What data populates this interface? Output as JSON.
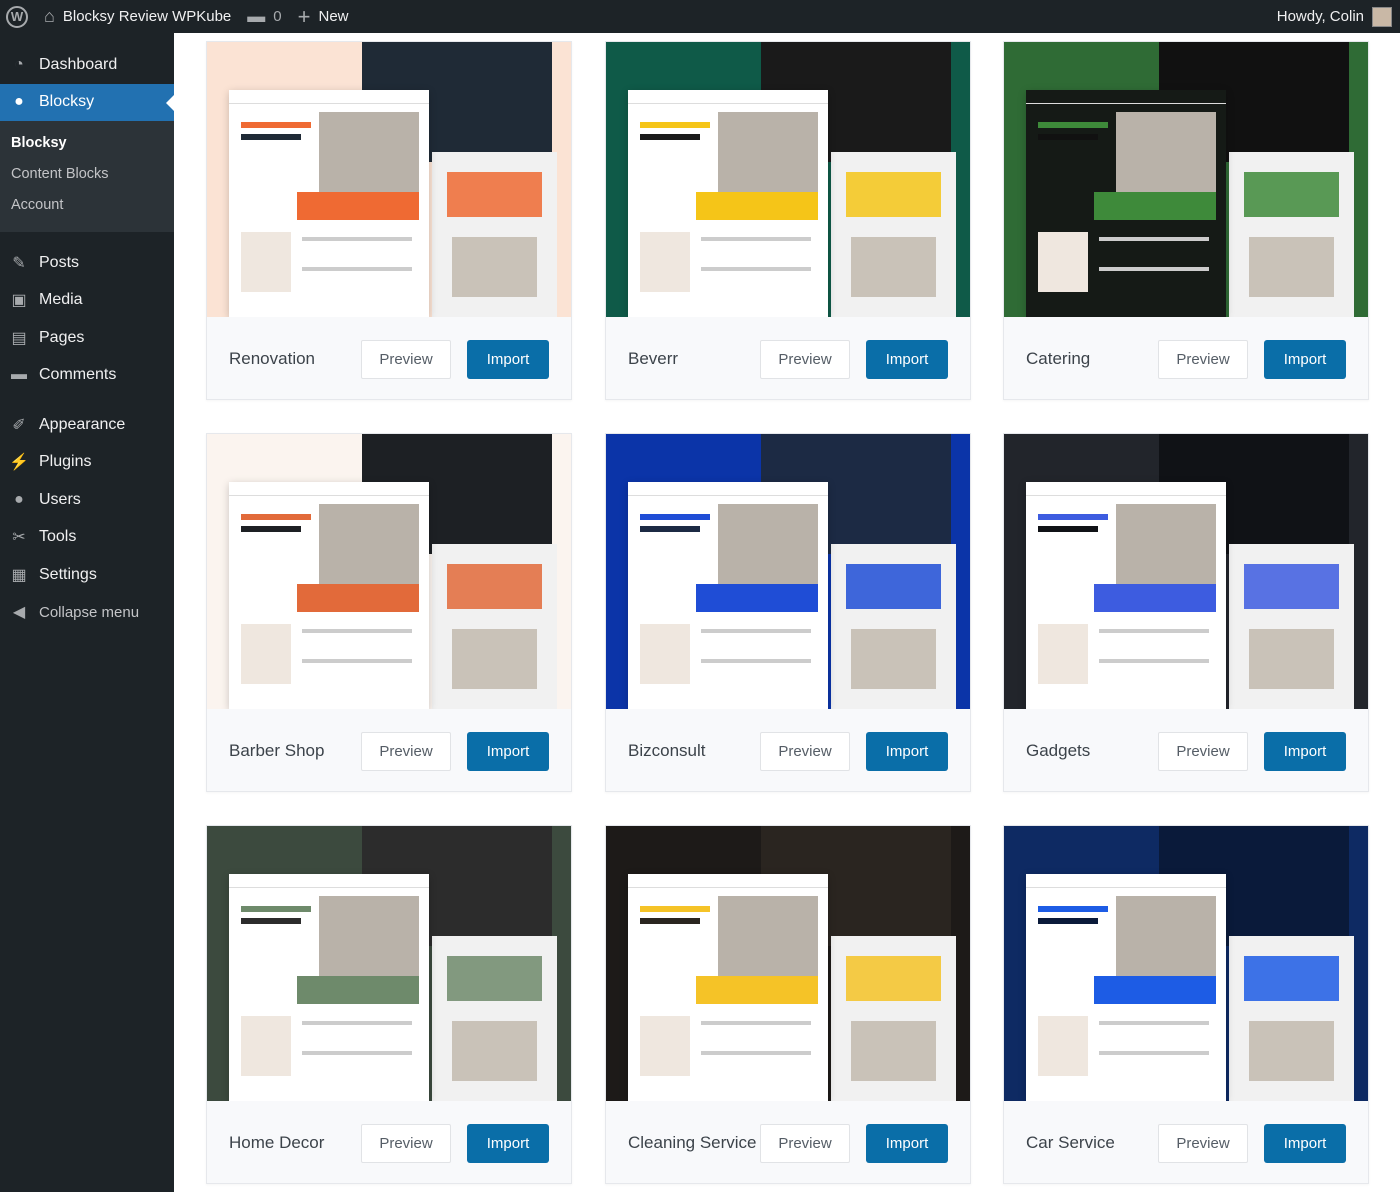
{
  "adminbar": {
    "site": "Blocksy Review WPKube",
    "comments": "0",
    "new": "New",
    "howdy": "Howdy, Colin"
  },
  "sidebar": {
    "items_top": [
      {
        "label": "Dashboard",
        "icon": "dashboard-icon",
        "glyph": "◔"
      },
      {
        "label": "Blocksy",
        "icon": "blocksy-icon",
        "glyph": "●"
      }
    ],
    "submenu": [
      "Blocksy",
      "Content Blocks",
      "Account"
    ],
    "items": [
      {
        "label": "Posts",
        "icon": "pin-icon",
        "glyph": "✎"
      },
      {
        "label": "Media",
        "icon": "media-icon",
        "glyph": "▣"
      },
      {
        "label": "Pages",
        "icon": "pages-icon",
        "glyph": "▤"
      },
      {
        "label": "Comments",
        "icon": "comment-icon",
        "glyph": "▬"
      }
    ],
    "items2": [
      {
        "label": "Appearance",
        "icon": "brush-icon",
        "glyph": "✐"
      },
      {
        "label": "Plugins",
        "icon": "plugin-icon",
        "glyph": "⚡"
      },
      {
        "label": "Users",
        "icon": "users-icon",
        "glyph": "●"
      },
      {
        "label": "Tools",
        "icon": "wrench-icon",
        "glyph": "✂"
      },
      {
        "label": "Settings",
        "icon": "settings-icon",
        "glyph": "▦"
      }
    ],
    "collapse": "Collapse menu"
  },
  "buttons": {
    "preview": "Preview",
    "import": "Import"
  },
  "starters": [
    {
      "name": "Renovation",
      "bg": "#fbe3d4",
      "panel": "#ffffff",
      "accent": "#ef6a33",
      "dark": "#1f2a36"
    },
    {
      "name": "Beverr",
      "bg": "#0f5a48",
      "panel": "#ffffff",
      "accent": "#f5c518",
      "dark": "#1a1a1a"
    },
    {
      "name": "Catering",
      "bg": "#2f6b35",
      "panel": "#151a16",
      "accent": "#3e8a3a",
      "dark": "#111111"
    },
    {
      "name": "Barber Shop",
      "bg": "#fbf4ef",
      "panel": "#ffffff",
      "accent": "#e26a3a",
      "dark": "#1d2024"
    },
    {
      "name": "Bizconsult",
      "bg": "#0b34a8",
      "panel": "#ffffff",
      "accent": "#1f4dd6",
      "dark": "#1c2a44"
    },
    {
      "name": "Gadgets",
      "bg": "#22252b",
      "panel": "#ffffff",
      "accent": "#3d5ce0",
      "dark": "#101216"
    },
    {
      "name": "Home Decor",
      "bg": "#3c4a3e",
      "panel": "#ffffff",
      "accent": "#6e8a6b",
      "dark": "#2c2c2c"
    },
    {
      "name": "Cleaning Service",
      "bg": "#1d1a18",
      "panel": "#ffffff",
      "accent": "#f5c327",
      "dark": "#2a2520"
    },
    {
      "name": "Car Service",
      "bg": "#0e2a63",
      "panel": "#ffffff",
      "accent": "#1d5ce5",
      "dark": "#0a1a3a"
    }
  ]
}
